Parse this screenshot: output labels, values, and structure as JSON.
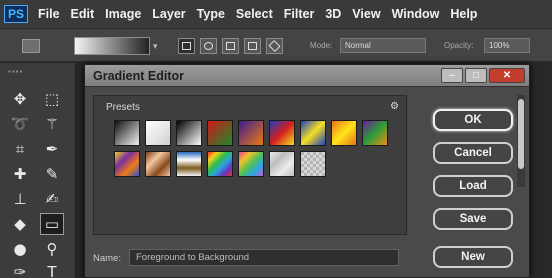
{
  "app": {
    "logo": "PS"
  },
  "menu": [
    "File",
    "Edit",
    "Image",
    "Layer",
    "Type",
    "Select",
    "Filter",
    "3D",
    "View",
    "Window",
    "Help"
  ],
  "options_bar": {
    "gradient_preview_colors": [
      "#f4f4f4",
      "#222222"
    ],
    "gradient_types": [
      "linear",
      "radial",
      "angle",
      "reflected",
      "diamond"
    ],
    "selected_type": "linear",
    "mode_label": "Mode:",
    "mode_value": "Normal",
    "opacity_label": "Opacity:",
    "opacity_value": "100%"
  },
  "tools": [
    "move-icon",
    "marquee-icon",
    "lasso-icon",
    "magic-wand-icon",
    "crop-icon",
    "eyedropper-icon",
    "healing-brush-icon",
    "brush-icon",
    "clone-stamp-icon",
    "history-brush-icon",
    "eraser-icon",
    "gradient-icon",
    "blur-icon",
    "dodge-icon",
    "pen-icon",
    "type-icon"
  ],
  "dialog": {
    "title": "Gradient Editor",
    "presets_label": "Presets",
    "name_label": "Name:",
    "name_value": "Foreground to Background",
    "buttons": {
      "ok": "OK",
      "cancel": "Cancel",
      "load": "Load",
      "save": "Save",
      "new": "New"
    },
    "swatches": [
      {
        "id": "fg-to-bg",
        "colors": [
          "#111111",
          "#f2f2f2"
        ],
        "dir": "135deg"
      },
      {
        "id": "fg-to-transparent",
        "colors": [
          "#ffffff",
          "#d0d0d0"
        ],
        "dir": "135deg"
      },
      {
        "id": "black-white",
        "colors": [
          "#000000",
          "#ffffff"
        ],
        "dir": "135deg"
      },
      {
        "id": "red-green",
        "colors": [
          "#d01818",
          "#1c8a2c"
        ],
        "dir": "135deg"
      },
      {
        "id": "violet-orange",
        "colors": [
          "#3b1c8f",
          "#ef7a14"
        ],
        "dir": "135deg"
      },
      {
        "id": "blue-red-yellow",
        "colors": [
          "#1d3fbf",
          "#d21f1f",
          "#f6e022"
        ],
        "dir": "135deg"
      },
      {
        "id": "blue-yellow-blue",
        "colors": [
          "#1d3fbf",
          "#f6e022",
          "#1d3fbf"
        ],
        "dir": "135deg"
      },
      {
        "id": "orange-yellow-orange",
        "colors": [
          "#e9741c",
          "#ffe41a",
          "#e9741c"
        ],
        "dir": "135deg"
      },
      {
        "id": "violet-green-orange",
        "colors": [
          "#6a1d9b",
          "#2e9d38",
          "#f28a18"
        ],
        "dir": "135deg"
      },
      {
        "id": "yellow-violet-orange-blue",
        "colors": [
          "#f4d31d",
          "#7a2f9f",
          "#ef7b16",
          "#2e54c8"
        ],
        "dir": "135deg"
      },
      {
        "id": "copper",
        "colors": [
          "#7c3a15",
          "#f2c7a0",
          "#8a4a1e",
          "#f2c7a0"
        ],
        "dir": "135deg"
      },
      {
        "id": "chrome",
        "colors": [
          "#2a6bbf",
          "#ffffff",
          "#7a5a20",
          "#f4f4f4"
        ],
        "dir": "180deg"
      },
      {
        "id": "spectrum",
        "colors": [
          "#f03030",
          "#f4d31d",
          "#30c04a",
          "#2aa0e0",
          "#6a30c0",
          "#f03030"
        ],
        "dir": "135deg"
      },
      {
        "id": "transparent-rainbow",
        "colors": [
          "#e83d8f",
          "#f3c12a",
          "#52c154",
          "#2aa6e6",
          "#c65dd0"
        ],
        "dir": "135deg"
      },
      {
        "id": "transparent-stripes",
        "colors": [
          "#ececec",
          "#bdbdbd",
          "#ececec",
          "#bdbdbd"
        ],
        "dir": "135deg"
      },
      {
        "id": "checker",
        "colors": [
          "#d8d8d8",
          "#b4b4b4"
        ],
        "dir": "135deg"
      }
    ]
  }
}
